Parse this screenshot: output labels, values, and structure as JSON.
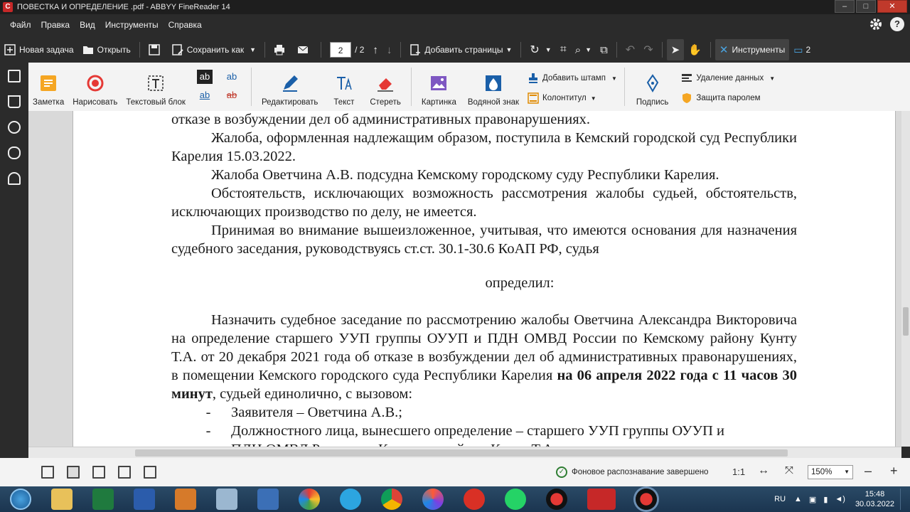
{
  "window": {
    "title": "ПОВЕСТКА И ОПРЕДЕЛЕНИЕ .pdf - ABBYY FineReader 14",
    "controls": [
      "–",
      "□",
      "✕"
    ]
  },
  "menu": [
    "Файл",
    "Правка",
    "Вид",
    "Инструменты",
    "Справка"
  ],
  "toolbar": {
    "new_task": "Новая задача",
    "open": "Открыть",
    "save_as": "Сохранить как",
    "page_current": "2",
    "page_total": "/ 2",
    "add_pages": "Добавить страницы",
    "tools": "Инструменты",
    "comments_count": "2"
  },
  "ribbon": {
    "note": "Заметка",
    "draw": "Нарисовать",
    "textbox": "Текстовый блок",
    "glyphs": [
      "ab",
      "ab",
      "ab",
      "ab"
    ],
    "edit": "Редактировать",
    "text": "Текст",
    "erase": "Стереть",
    "picture": "Картинка",
    "watermark": "Водяной знак",
    "add_stamp": "Добавить штамп",
    "header_footer": "Колонтитул",
    "sign": "Подпись",
    "redact": "Удаление данных",
    "password": "Защита паролем"
  },
  "document": {
    "l1": "отказе в возбуждении дел об административных правонарушениях.",
    "p2": "Жалоба, оформленная надлежащим образом, поступила в Кемский городской суд Республики Карелия 15.03.2022.",
    "p3": "Жалоба Оветчина А.В. подсудна Кемскому городскому суду Республики Карелия.",
    "p4": "Обстоятельств, исключающих возможность рассмотрения жалобы судьей, обстоятельств, исключающих производство по делу, не имеется.",
    "p5": "Принимая во внимание вышеизложенное, учитывая, что имеются основания для назначения судебного заседания, руководствуясь ст.ст. 30.1-30.6 КоАП РФ, судья",
    "heading": "определил:",
    "p6_a": "Назначить судебное заседание по рассмотрению жалобы Оветчина Александра Викторовича на определение старшего УУП группы ОУУП и ПДН ОМВД России по Кемскому району Кунту Т.А. от 20 декабря 2021 года об отказе в возбуждении дел об административных правонарушениях, в помещении Кемского городского суда Республики Карелия ",
    "p6_bold": "на 06 апреля 2022 года с 11 часов 30 минут",
    "p6_c": ", судьей единолично, с вызовом:",
    "dash": "-",
    "item1": "Заявителя – Оветчина А.В.;",
    "item2": "Должностного лица, вынесшего определение – старшего УУП группы ОУУП и",
    "item3": "ПДН ОМВД России по Кемскому району Кунту Т.А."
  },
  "status": {
    "message": "Фоновое распознавание завершено",
    "ratio": "1:1",
    "zoom": "150%",
    "minus": "–",
    "plus": "+"
  },
  "taskbar": {
    "lang": "RU",
    "time": "15:48",
    "date": "30.03.2022"
  },
  "colors": {
    "accent": "#c62828",
    "ribbon_bg": "#f3f3f3",
    "chrome_bg": "#2b2b2b"
  }
}
